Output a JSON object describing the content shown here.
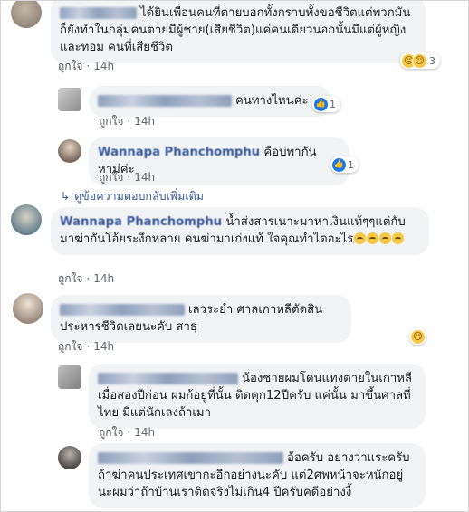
{
  "ui": {
    "like_label": "ถูกใจ",
    "separator": "·",
    "more_replies_icon": "reply-arrow-icon",
    "colors": {
      "link": "#385898",
      "bubble": "#f2f3f5",
      "meta": "#606770",
      "like": "#1877f2"
    }
  },
  "comments": [
    {
      "text": "ได้ยินเพื่อนคนที่ตายบอกทั้งกราบทั้งขอชีวิตแต่พวกมันก็ยังทำในกลุ่มคนตายมีผู้ชาย(เสียชีวิต)แค่คนเดียวนอกนั้นมีแต่ผู้หญิงและทอม คนที่เสียชีวิต",
      "time": "14h",
      "reactions": {
        "icons": [
          "sad-icon",
          "laugh-icon"
        ],
        "count": "3"
      }
    },
    {
      "text": "คนทางไหนค่ะ",
      "time": "14h",
      "reactions": {
        "icons": [
          "like-icon"
        ],
        "count": "1"
      }
    },
    {
      "author": "Wannapa Phanchomphu",
      "text": "คือบ่พากันหาม่ค่ะ",
      "time": "14h",
      "reactions": {
        "icons": [
          "like-icon"
        ],
        "count": "1"
      }
    },
    {
      "more_replies": "ดูข้อความตอบกลับเพิ่มเติม"
    },
    {
      "author": "Wannapa Phanchomphu",
      "text": "น้ำส่งสารเนาะมาหาเงินแท้ๆๆแต่กับมาฆ่ากันโอ้ยระงึกหลาย คนฆ่ามาเก่งแท้ ใจคุณทำไดอะไร",
      "time": "14h"
    },
    {
      "text": "เลวระยำ ศาลเกาหลีตัดสินประหารชีวิตเลยนะคับ สาธุ",
      "time": "14h",
      "reactions": {
        "icons": [
          "sad-icon"
        ]
      }
    },
    {
      "text": "น้องชายผมโดนแทงตายในเกาหลีเมื่อสองปีก่อน ผมก้อยู่ที่นั้น ติดคุก12ปีครับ แค่นั้น มาขึ้นศาลที่ไทย มีแต่นักเลงถ้าเมา",
      "time": "14h"
    },
    {
      "text": "อ้อครับ อย่างว่าแระครับ ถ้าฆ่าคนประเทศเขากะอีกอย่างนะคับ แต่2ศพหน้าจะหนักอยู่นะผมว่าถ้าบ้านเราติดจริงไม่เกิน4 ปีครับคดีอย่างงี้"
    }
  ]
}
